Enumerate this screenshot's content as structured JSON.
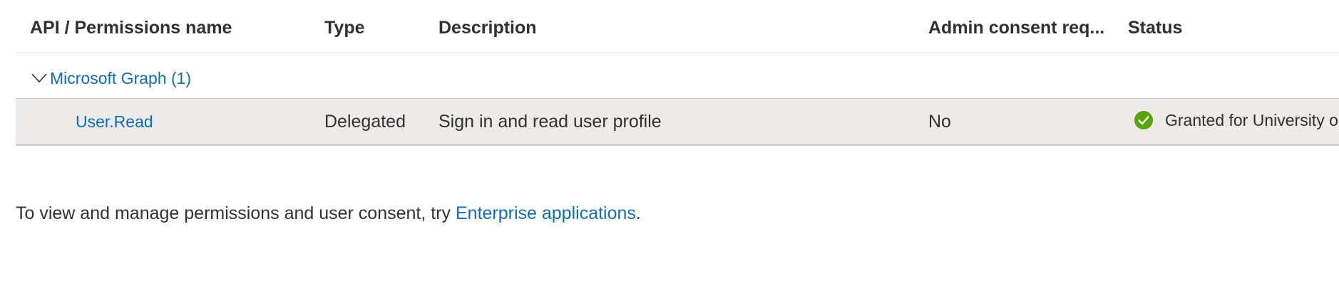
{
  "table": {
    "columns": {
      "name": "API / Permissions name",
      "type": "Type",
      "description": "Description",
      "admin_consent": "Admin consent req...",
      "status": "Status"
    },
    "groups": [
      {
        "label": "Microsoft Graph (1)",
        "expanded": true,
        "permissions": [
          {
            "name": "User.Read",
            "type": "Delegated",
            "description": "Sign in and read user profile",
            "admin_consent": "No",
            "status": "Granted for University o",
            "status_icon": "check-circle-icon"
          }
        ]
      }
    ]
  },
  "footer": {
    "text_prefix": "To view and manage permissions and user consent, try ",
    "link_text": "Enterprise applications",
    "text_suffix": "."
  },
  "colors": {
    "link": "#0f6cbd",
    "row_highlight": "#edebe9",
    "success": "#57a300"
  }
}
